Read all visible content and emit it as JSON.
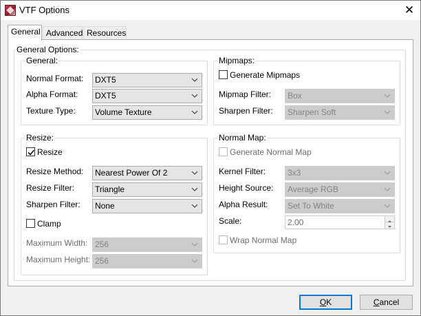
{
  "window": {
    "title": "VTF Options",
    "icon": "vtf-app-icon",
    "close_glyph": "✕"
  },
  "tabs": [
    {
      "label": "General",
      "active": true
    },
    {
      "label": "Advanced",
      "active": false
    },
    {
      "label": "Resources",
      "active": false
    }
  ],
  "general_options": {
    "label": "General Options:",
    "general": {
      "label": "General:",
      "normal_format": {
        "label": "Normal Format:",
        "value": "DXT5"
      },
      "alpha_format": {
        "label": "Alpha Format:",
        "value": "DXT5"
      },
      "texture_type": {
        "label": "Texture Type:",
        "value": "Volume Texture"
      }
    },
    "mipmaps": {
      "label": "Mipmaps:",
      "generate": {
        "label": "Generate Mipmaps",
        "checked": false
      },
      "mipmap_filter": {
        "label": "Mipmap Filter:",
        "value": "Box",
        "enabled": false
      },
      "sharpen_filter": {
        "label": "Sharpen Filter:",
        "value": "Sharpen Soft",
        "enabled": false
      }
    },
    "resize": {
      "label": "Resize:",
      "resize": {
        "label": "Resize",
        "checked": true
      },
      "resize_method": {
        "label": "Resize Method:",
        "value": "Nearest Power Of 2"
      },
      "resize_filter": {
        "label": "Resize Filter:",
        "value": "Triangle"
      },
      "sharpen_filter": {
        "label": "Sharpen Filter:",
        "value": "None"
      },
      "clamp": {
        "label": "Clamp",
        "checked": false
      },
      "max_width": {
        "label": "Maximum Width:",
        "value": "256",
        "enabled": false
      },
      "max_height": {
        "label": "Maximum Height:",
        "value": "256",
        "enabled": false
      }
    },
    "normal_map": {
      "label": "Normal Map:",
      "generate": {
        "label": "Generate Normal Map",
        "checked": false,
        "enabled": false
      },
      "kernel_filter": {
        "label": "Kernel Filter:",
        "value": "3x3",
        "enabled": false
      },
      "height_source": {
        "label": "Height Source:",
        "value": "Average RGB",
        "enabled": false
      },
      "alpha_result": {
        "label": "Alpha Result:",
        "value": "Set To White",
        "enabled": false
      },
      "scale": {
        "label": "Scale:",
        "value": "2.00",
        "enabled": false
      },
      "wrap": {
        "label": "Wrap Normal Map",
        "checked": false,
        "enabled": false
      }
    }
  },
  "buttons": {
    "ok": {
      "mnemonic": "O",
      "rest": "K"
    },
    "cancel": {
      "mnemonic": "C",
      "rest": "ancel"
    }
  },
  "colors": {
    "accent": "#0078d7",
    "window_bg": "#f0f0f0",
    "panel_bg": "#ffffff",
    "disabled_text": "#6d6d6d"
  }
}
